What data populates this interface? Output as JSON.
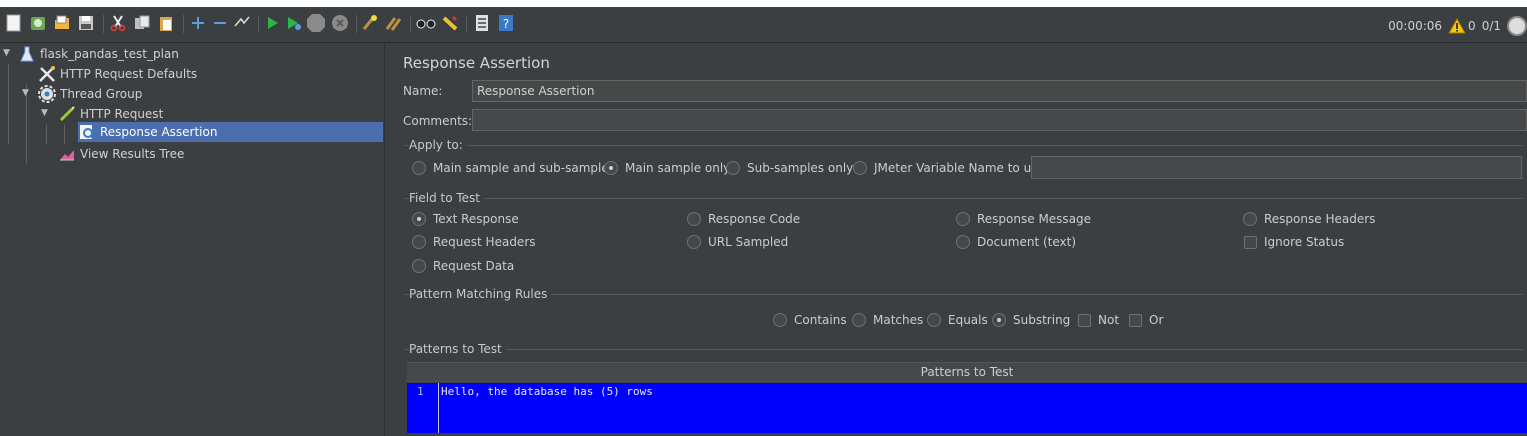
{
  "toolbar": {
    "icons": [
      "new-icon",
      "templates-icon",
      "open-icon",
      "save-icon",
      "cut-icon",
      "copy-icon",
      "paste-icon",
      "expand-icon",
      "collapse-icon",
      "toggle-icon",
      "start-icon",
      "start-no-timers-icon",
      "stop-icon",
      "shutdown-icon",
      "clear-icon",
      "clear-all-icon",
      "search-icon",
      "reset-search-icon",
      "function-helper-icon",
      "help-icon"
    ],
    "elapsed": "00:00:06",
    "warnings": "0",
    "threads": "0/1"
  },
  "tree": {
    "nodes": [
      {
        "label": "flask_pandas_test_plan",
        "icon": "test-plan-icon"
      },
      {
        "label": "HTTP Request Defaults",
        "icon": "config-tools-icon"
      },
      {
        "label": "Thread Group",
        "icon": "gear-icon"
      },
      {
        "label": "HTTP Request",
        "icon": "pen-icon"
      },
      {
        "label": "Response Assertion",
        "icon": "assertion-icon"
      },
      {
        "label": "View Results Tree",
        "icon": "chart-icon"
      }
    ]
  },
  "panel": {
    "title": "Response Assertion",
    "name_label": "Name:",
    "name_value": "Response Assertion",
    "comments_label": "Comments:",
    "comments_value": "",
    "apply_to": {
      "legend": "Apply to:",
      "options": [
        "Main sample and sub-samples",
        "Main sample only",
        "Sub-samples only",
        "JMeter Variable Name to use"
      ],
      "selected": "Main sample only",
      "variable_value": ""
    },
    "field_to_test": {
      "legend": "Field to Test",
      "options": [
        "Text Response",
        "Response Code",
        "Response Message",
        "Response Headers",
        "Request Headers",
        "URL Sampled",
        "Document (text)",
        "Request Data"
      ],
      "selected": "Text Response",
      "ignore_status_label": "Ignore Status",
      "ignore_status_checked": false
    },
    "pattern_matching": {
      "legend": "Pattern Matching Rules",
      "options": [
        "Contains",
        "Matches",
        "Equals",
        "Substring"
      ],
      "selected": "Substring",
      "not_label": "Not",
      "not_checked": false,
      "or_label": "Or",
      "or_checked": false
    },
    "patterns": {
      "legend": "Patterns to Test",
      "column_header": "Patterns to Test",
      "rows": [
        {
          "line": "1",
          "text": "Hello, the database has (5) rows"
        }
      ]
    }
  }
}
